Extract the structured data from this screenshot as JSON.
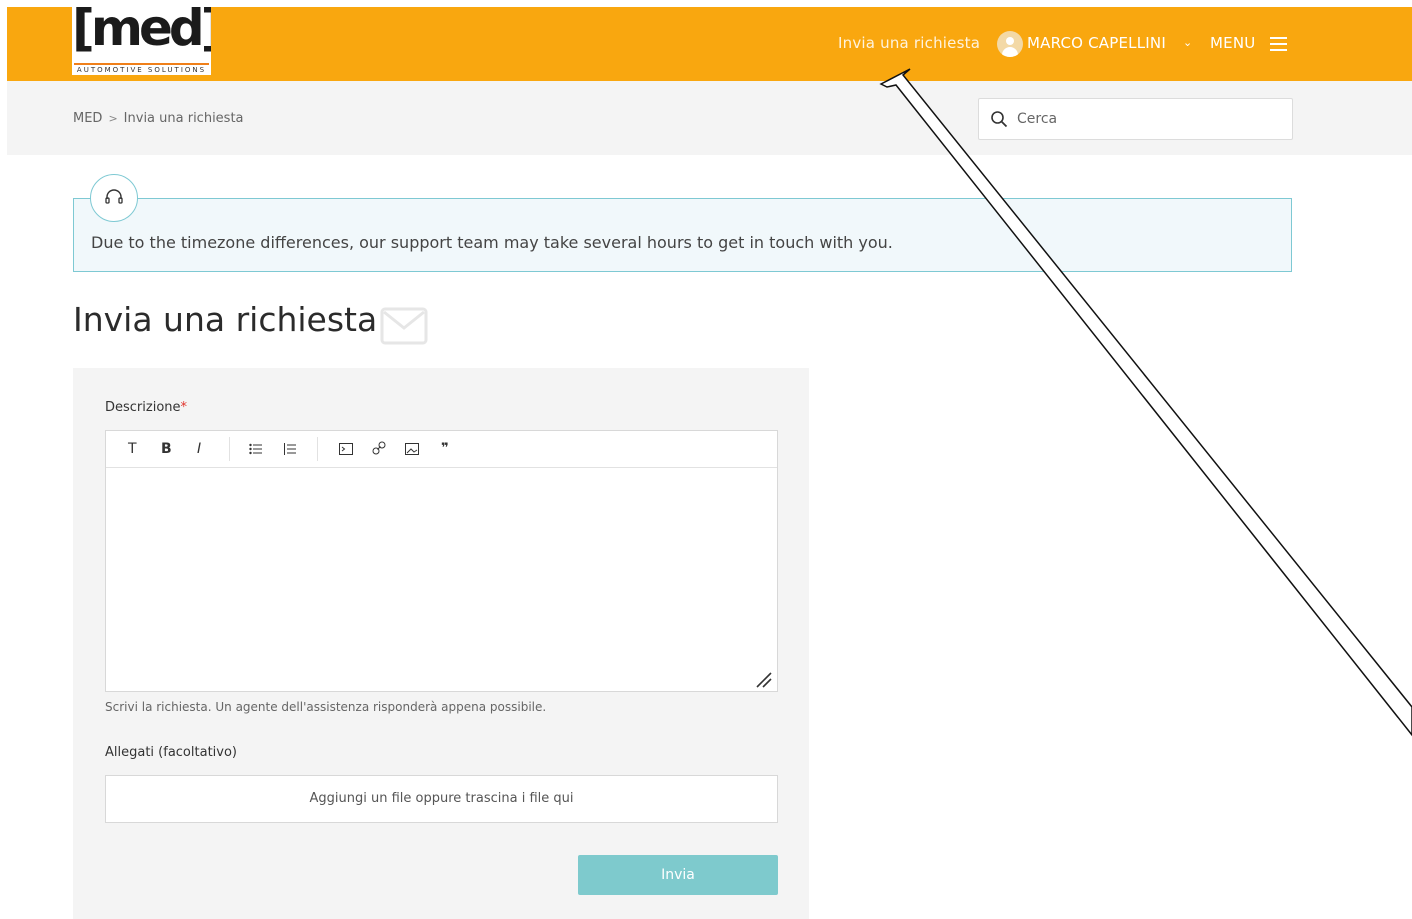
{
  "header": {
    "logo_text": "[med]",
    "logo_tagline": "AUTOMOTIVE SOLUTIONS",
    "nav_request": "Invia una richiesta",
    "user_name": "MARCO CAPELLINI",
    "menu_label": "MENU"
  },
  "breadcrumb": {
    "items": [
      "MED",
      "Invia una richiesta"
    ],
    "separator": ">"
  },
  "search": {
    "placeholder": "Cerca"
  },
  "notice": {
    "text": "Due to the timezone differences, our support team may take several hours to get in touch with you."
  },
  "page": {
    "title": "Invia una richiesta"
  },
  "form": {
    "description_label": "Descrizione",
    "required_marker": "*",
    "toolbar": {
      "text": "T",
      "bold": "B",
      "italic": "I",
      "quote": "❞"
    },
    "editor_value": "",
    "help_text": "Scrivi la richiesta. Un agente dell'assistenza risponderà appena possibile.",
    "attachments_label": "Allegati (facoltativo)",
    "dropzone_text": "Aggiungi un file oppure trascina i file qui",
    "submit_label": "Invia"
  },
  "colors": {
    "brand_orange": "#f9a70f",
    "notice_border": "#7ec9d3",
    "submit_bg": "#7ecacd"
  },
  "icons": [
    "user-avatar-icon",
    "hamburger-menu-icon",
    "search-icon",
    "headset-icon",
    "envelope-icon",
    "bullet-list-icon",
    "numbered-list-icon",
    "code-icon",
    "link-icon",
    "image-icon",
    "quote-icon",
    "resize-handle-icon"
  ]
}
